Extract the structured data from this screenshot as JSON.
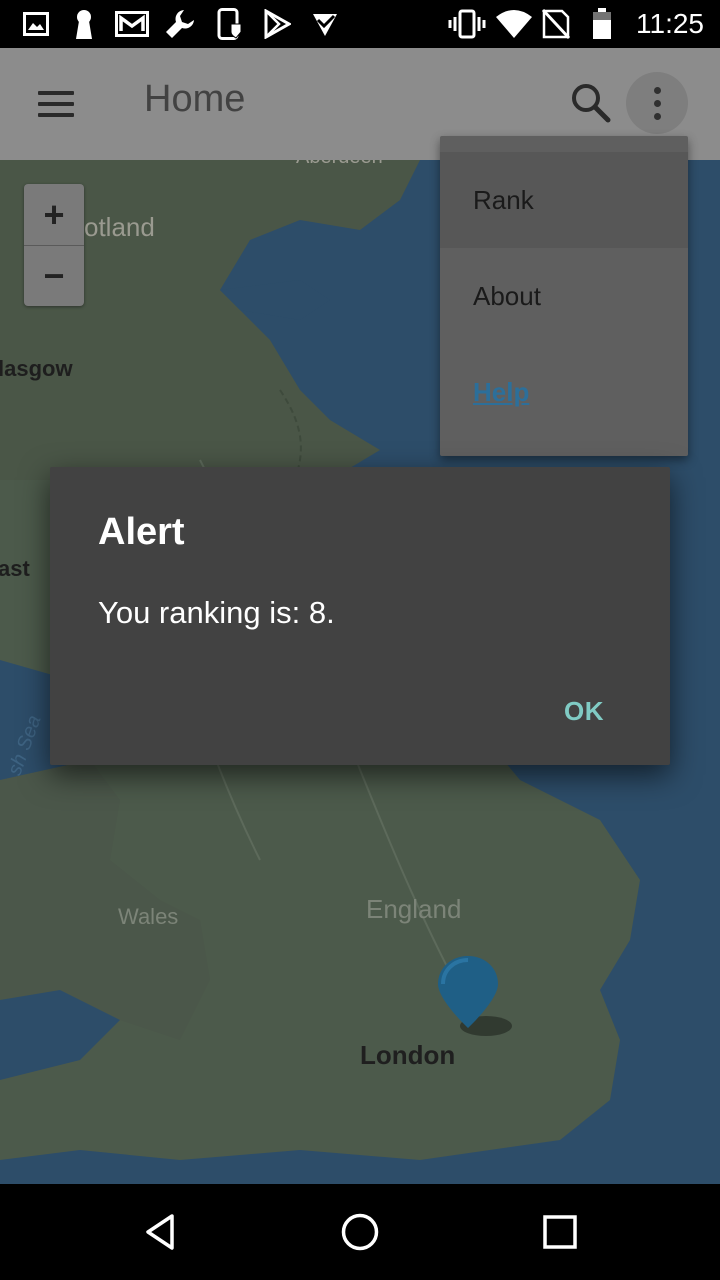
{
  "status_bar": {
    "time": "11:25",
    "left_icons": [
      "image-icon",
      "keyhole-icon",
      "gmail-icon",
      "wrench-icon",
      "phone-shield-icon",
      "play-store-icon",
      "check-icon"
    ],
    "right_icons": [
      "vibrate-icon",
      "wifi-icon",
      "no-sim-icon",
      "battery-icon"
    ]
  },
  "app_bar": {
    "title": "Home",
    "menu_icon": "hamburger-icon",
    "search_icon": "search-icon",
    "more_icon": "more-vert-icon"
  },
  "map": {
    "labels": {
      "aberdeen": "Aberdeen",
      "scotland": "otland",
      "glasgow": "lasgow",
      "east": "ast",
      "irish_sea": "sh Sea",
      "wales": "Wales",
      "england": "England",
      "london": "London"
    },
    "zoom_in": "+",
    "zoom_out": "−",
    "marker_icon": "map-marker-icon"
  },
  "overflow_menu": {
    "items": [
      {
        "label": "Rank"
      },
      {
        "label": "About"
      },
      {
        "label": "Help"
      }
    ]
  },
  "dialog": {
    "title": "Alert",
    "message": "You ranking is: 8.",
    "ok_label": "OK"
  },
  "nav_bar": {
    "back_icon": "back-triangle-icon",
    "home_icon": "home-circle-icon",
    "recents_icon": "recents-square-icon"
  },
  "colors": {
    "dialog_bg": "#424242",
    "ok_accent": "#80cbc4",
    "link": "#2c6f9a",
    "marker": "#1f5f86"
  }
}
